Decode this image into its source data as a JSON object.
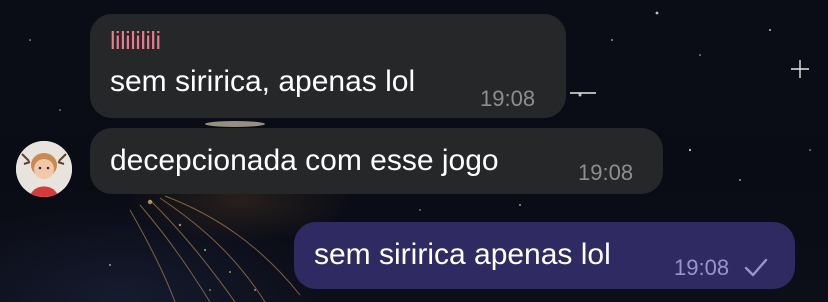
{
  "chat": {
    "messages": [
      {
        "direction": "incoming",
        "sender": "lilililili",
        "text": "sem siririca, apenas lol",
        "time": "19:08"
      },
      {
        "direction": "incoming",
        "text": "decepcionada com esse jogo",
        "time": "19:08",
        "has_avatar": true
      },
      {
        "direction": "outgoing",
        "text": "sem siririca apenas lol",
        "time": "19:08",
        "status_icon": "single-check-icon"
      }
    ]
  },
  "colors": {
    "incoming_bubble": "#262729",
    "outgoing_bubble": "#2f2a62",
    "sender_name": "#e57b8b",
    "background": "#080a12"
  }
}
